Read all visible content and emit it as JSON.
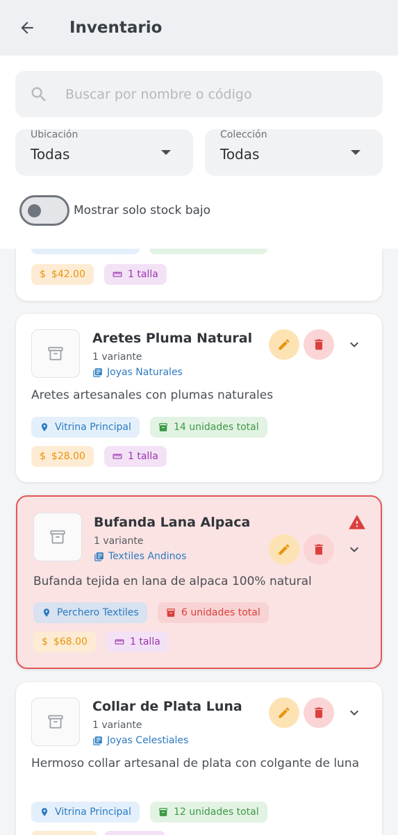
{
  "appbar": {
    "title": "Inventario",
    "back_icon": "arrow-left-icon"
  },
  "filters": {
    "search_placeholder": "Buscar por nombre o código",
    "location": {
      "label": "Ubicación",
      "value": "Todas"
    },
    "collection": {
      "label": "Colección",
      "value": "Todas"
    },
    "low_stock_toggle": {
      "label": "Mostrar solo stock bajo",
      "on": false
    }
  },
  "colors": {
    "accent_blue": "#2b7bc0",
    "stock_green": "#3e9a45",
    "alert_red": "#d9403f",
    "price_orange": "#e8940d",
    "size_purple": "#9b35ad"
  },
  "partial_card": {
    "price": "$42.00",
    "sizes": "1 talla"
  },
  "products": [
    {
      "name": "Aretes Pluma Natural",
      "variants": "1 variante",
      "collection": "Joyas Naturales",
      "description": "Aretes artesanales con plumas naturales",
      "location": "Vitrina Principal",
      "stock": "14 unidades total",
      "price": "$28.00",
      "sizes": "1 talla",
      "low_stock": false
    },
    {
      "name": "Bufanda Lana Alpaca",
      "variants": "1 variante",
      "collection": "Textiles Andinos",
      "description": "Bufanda tejida en lana de alpaca 100% natural",
      "location": "Perchero Textiles",
      "stock": "6 unidades total",
      "price": "$68.00",
      "sizes": "1 talla",
      "low_stock": true
    },
    {
      "name": "Collar de Plata Luna",
      "variants": "1 variante",
      "collection": "Joyas Celestiales",
      "description": "Hermoso collar artesanal de plata con colgante de luna",
      "location": "Vitrina Principal",
      "stock": "12 unidades total",
      "low_stock": false
    }
  ]
}
